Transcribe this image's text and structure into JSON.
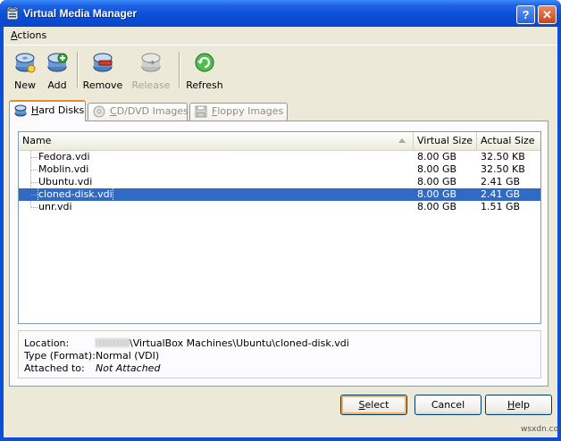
{
  "window": {
    "title": "Virtual Media Manager",
    "help_button": "?",
    "close_button": "✕"
  },
  "menubar": {
    "items": [
      {
        "label": "Actions",
        "mnemonic": "A",
        "rest": "ctions"
      }
    ]
  },
  "toolbar": {
    "buttons": [
      {
        "label": "New",
        "icon": "new-disk-icon",
        "enabled": true
      },
      {
        "label": "Add",
        "icon": "add-disk-icon",
        "enabled": true
      },
      {
        "label": "Remove",
        "icon": "remove-disk-icon",
        "enabled": true
      },
      {
        "label": "Release",
        "icon": "release-disk-icon",
        "enabled": false
      },
      {
        "label": "Refresh",
        "icon": "refresh-icon",
        "enabled": true
      }
    ]
  },
  "tabs": [
    {
      "label": "Hard Disks",
      "mnemonic": "H",
      "rest": "ard Disks",
      "active": true,
      "icon": "hard-disk-icon"
    },
    {
      "label": "CD/DVD Images",
      "mnemonic": "C",
      "rest": "D/DVD Images",
      "active": false,
      "icon": "cd-icon"
    },
    {
      "label": "Floppy Images",
      "mnemonic": "F",
      "rest": "loppy Images",
      "active": false,
      "icon": "floppy-icon"
    }
  ],
  "list": {
    "columns": [
      "Name",
      "Virtual Size",
      "Actual Size"
    ],
    "rows": [
      {
        "name": "Fedora.vdi",
        "virtual_size": "8.00 GB",
        "actual_size": "32.50 KB",
        "selected": false
      },
      {
        "name": "Moblin.vdi",
        "virtual_size": "8.00 GB",
        "actual_size": "32.50 KB",
        "selected": false
      },
      {
        "name": "Ubuntu.vdi",
        "virtual_size": "8.00 GB",
        "actual_size": "2.41 GB",
        "selected": false
      },
      {
        "name": "cloned-disk.vdi",
        "virtual_size": "8.00 GB",
        "actual_size": "2.41 GB",
        "selected": true
      },
      {
        "name": "unr.vdi",
        "virtual_size": "8.00 GB",
        "actual_size": "1.51 GB",
        "selected": false
      }
    ]
  },
  "info": {
    "location_label": "Location:",
    "location_value": "\\VirtualBox Machines\\Ubuntu\\cloned-disk.vdi",
    "type_label": "Type (Format):",
    "type_value": "Normal (VDI)",
    "attached_label": "Attached to:",
    "attached_value": "Not Attached"
  },
  "buttons": {
    "select": {
      "label": "Select",
      "mnemonic": "S",
      "rest": "elect"
    },
    "cancel": {
      "label": "Cancel"
    },
    "help": {
      "label": "Help",
      "mnemonic": "H",
      "rest": "elp"
    }
  },
  "watermark": "wsxdn.com",
  "colors": {
    "titlebar": "#0b4fd8",
    "selection": "#316ac5",
    "client_bg": "#ece9d8",
    "active_tab_accent": "#e68b2c"
  }
}
